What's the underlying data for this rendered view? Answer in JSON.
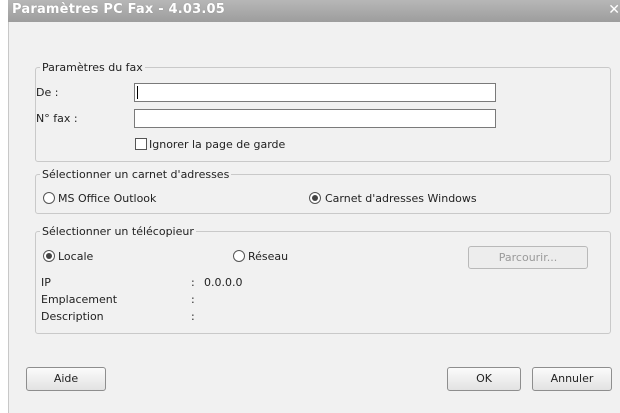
{
  "window": {
    "title": "Paramètres PC Fax - 4.03.05"
  },
  "fax_settings": {
    "legend": "Paramètres du fax",
    "from_label": "De :",
    "from_value": "",
    "fax_number_label": "N° fax :",
    "fax_number_value": "",
    "ignore_cover_label": "Ignorer la page de garde",
    "ignore_cover_checked": false
  },
  "address_book": {
    "legend": "Sélectionner un carnet d'adresses",
    "options": [
      {
        "label": "MS Office Outlook",
        "selected": false
      },
      {
        "label": "Carnet d'adresses Windows",
        "selected": true
      }
    ]
  },
  "fax_device": {
    "legend": "Sélectionner un télécopieur",
    "options": [
      {
        "label": "Locale",
        "selected": true
      },
      {
        "label": "Réseau",
        "selected": false
      }
    ],
    "browse_button": "Parcourir...",
    "info": [
      {
        "label": "IP",
        "sep": ":",
        "value": "0.0.0.0"
      },
      {
        "label": "Emplacement",
        "sep": ":",
        "value": ""
      },
      {
        "label": "Description",
        "sep": ":",
        "value": ""
      }
    ]
  },
  "buttons": {
    "help": "Aide",
    "ok": "OK",
    "cancel": "Annuler"
  }
}
